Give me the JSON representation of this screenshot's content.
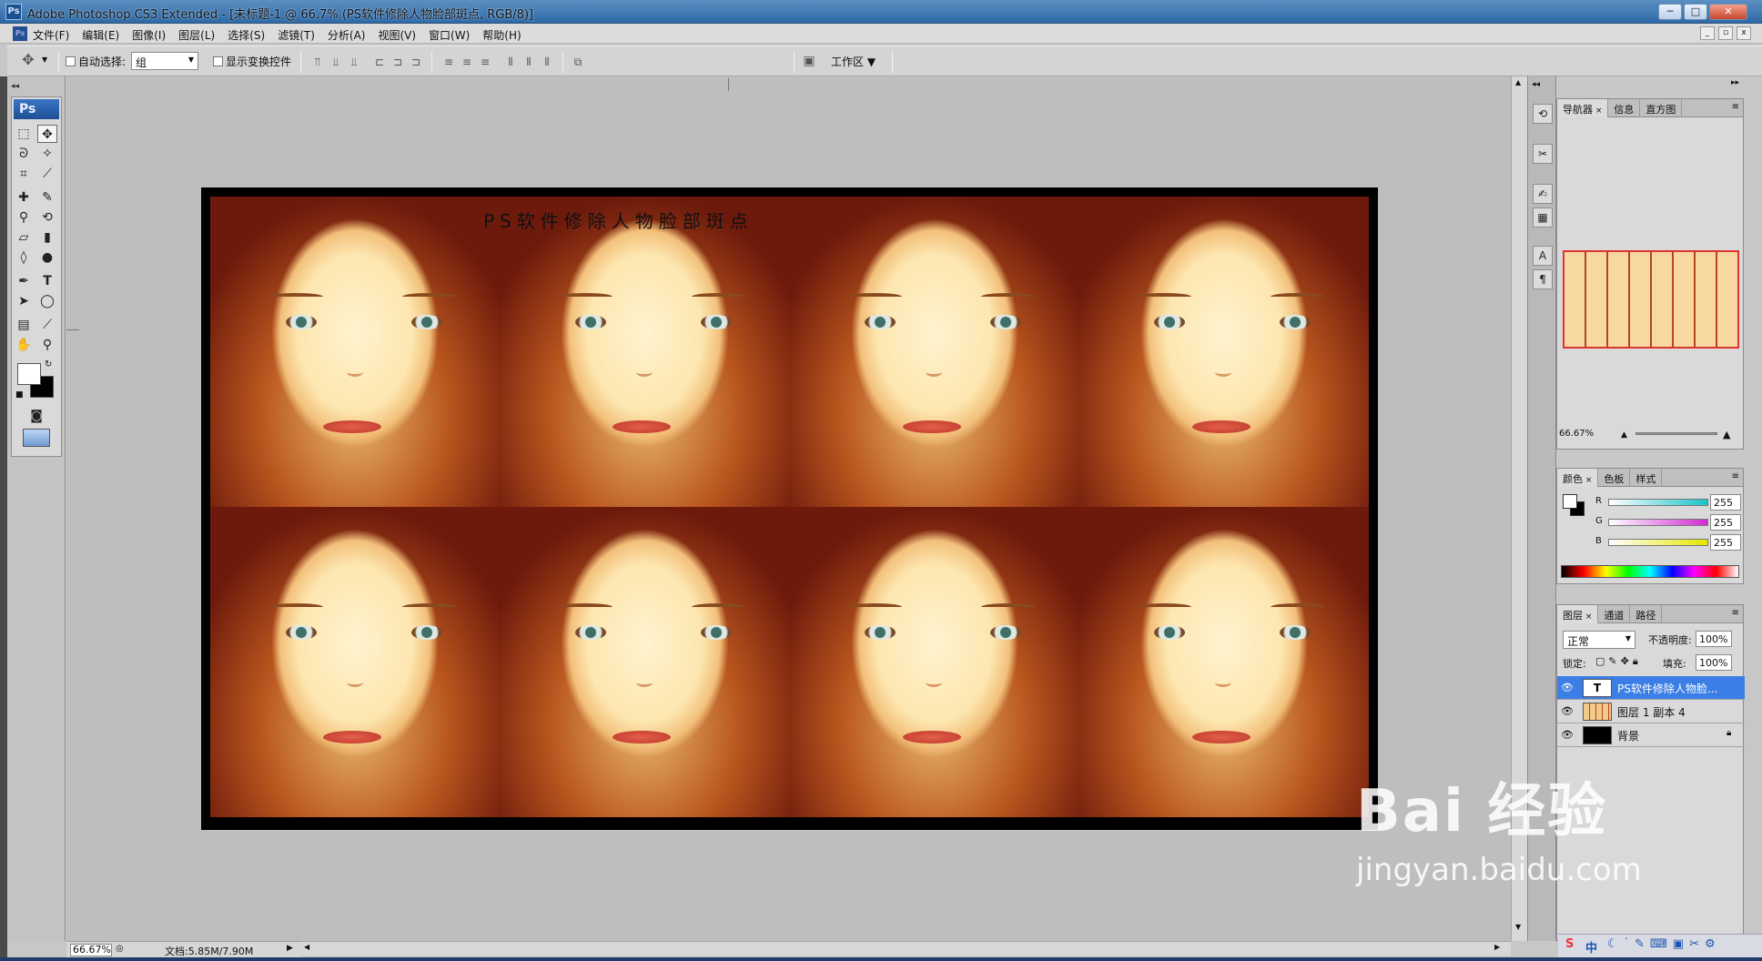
{
  "window": {
    "title": "Adobe Photoshop CS3 Extended - [未标题-1 @ 66.7% (PS软件修除人物脸部斑点, RGB/8)]",
    "app_badge": "Ps",
    "min_label": "─",
    "max_label": "□",
    "close_label": "✕"
  },
  "menu": {
    "items": [
      "文件(F)",
      "编辑(E)",
      "图像(I)",
      "图层(L)",
      "选择(S)",
      "滤镜(T)",
      "分析(A)",
      "视图(V)",
      "窗口(W)",
      "帮助(H)"
    ]
  },
  "options": {
    "auto_select_label": "自动选择:",
    "auto_select_value": "组",
    "show_transform_label": "显示变换控件",
    "workspace_label": "工作区"
  },
  "toolbox": {
    "header": "Ps"
  },
  "document": {
    "overlay_text": "PS软件修除人物脸部斑点"
  },
  "status": {
    "zoom": "66.67%",
    "doc_size": "文档:5.85M/7.90M"
  },
  "navigator": {
    "tabs": [
      "导航器",
      "信息",
      "直方图"
    ],
    "zoom": "66.67%"
  },
  "color_panel": {
    "tabs": [
      "颜色",
      "色板",
      "样式"
    ],
    "channels": [
      {
        "label": "R",
        "value": "255",
        "color": "#19c3c9"
      },
      {
        "label": "G",
        "value": "255",
        "color": "#d12bd3"
      },
      {
        "label": "B",
        "value": "255",
        "color": "#e6e600"
      }
    ]
  },
  "layers_panel": {
    "tabs": [
      "图层",
      "通道",
      "路径"
    ],
    "blend_mode": "正常",
    "opacity_label": "不透明度:",
    "opacity_value": "100%",
    "lock_label": "锁定:",
    "fill_label": "填充:",
    "fill_value": "100%",
    "layers": [
      {
        "name": "PS软件修除人物脸...",
        "type": "text",
        "selected": true
      },
      {
        "name": "图层 1 副本 4",
        "type": "image",
        "selected": false
      },
      {
        "name": "背景",
        "type": "background",
        "selected": false
      }
    ]
  },
  "watermark": {
    "brand": "Bai 经验",
    "url": "jingyan.baidu.com"
  },
  "tray": {
    "ime": "中"
  },
  "colors": {
    "accent": "#2e6aa7",
    "selected_layer": "#3a7ee6"
  }
}
